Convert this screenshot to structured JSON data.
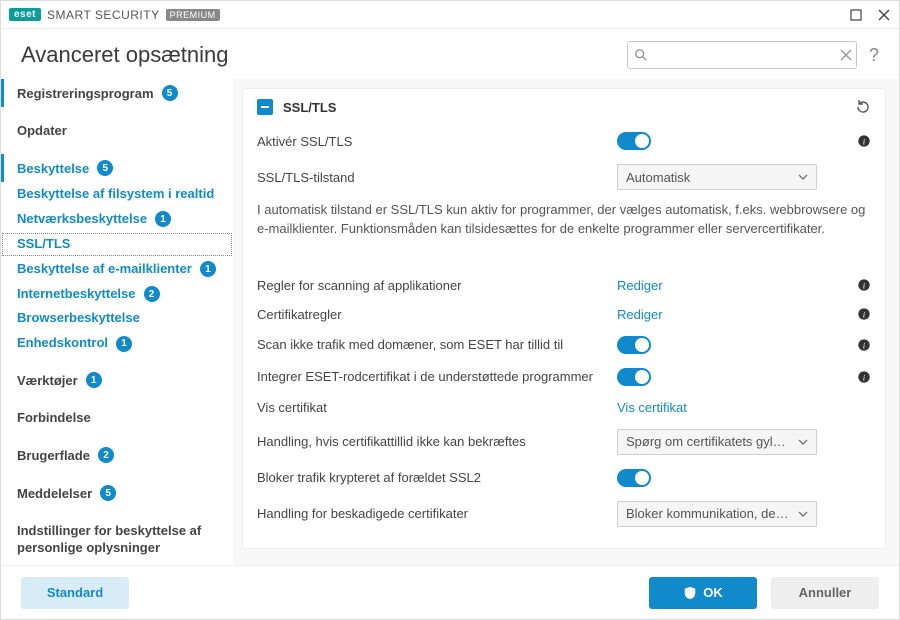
{
  "titlebar": {
    "brand_eset": "eset",
    "brand_name": "SMART SECURITY",
    "brand_premium": "PREMIUM"
  },
  "header": {
    "page_title": "Avanceret opsætning",
    "search_placeholder": ""
  },
  "sidebar": {
    "items": [
      {
        "label": "Registreringsprogram",
        "badge": "5",
        "style": "top"
      },
      {
        "label": "Opdater",
        "style": "top"
      },
      {
        "label": "Beskyttelse",
        "badge": "5",
        "style": "blue-active"
      },
      {
        "label": "Beskyttelse af filsystem i realtid",
        "style": "child"
      },
      {
        "label": "Netværksbeskyttelse",
        "badge": "1",
        "style": "child"
      },
      {
        "label": "SSL/TLS",
        "style": "selected"
      },
      {
        "label": "Beskyttelse af e-mailklienter",
        "badge": "1",
        "style": "child"
      },
      {
        "label": "Internetbeskyttelse",
        "badge": "2",
        "style": "child"
      },
      {
        "label": "Browserbeskyttelse",
        "style": "child"
      },
      {
        "label": "Enhedskontrol",
        "badge": "1",
        "style": "child"
      },
      {
        "label": "Værktøjer",
        "badge": "1",
        "style": "top"
      },
      {
        "label": "Forbindelse",
        "style": "top"
      },
      {
        "label": "Brugerflade",
        "badge": "2",
        "style": "top"
      },
      {
        "label": "Meddelelser",
        "badge": "5",
        "style": "top"
      },
      {
        "label": "Indstillinger for beskyttelse af personlige oplysninger",
        "style": "top-multiline"
      }
    ]
  },
  "panel": {
    "title": "SSL/TLS",
    "rows": {
      "enable_label": "Aktivér SSL/TLS",
      "mode_label": "SSL/TLS-tilstand",
      "mode_value": "Automatisk",
      "description": "I automatisk tilstand er SSL/TLS kun aktiv for programmer, der vælges automatisk, f.eks. webbrowsere og e-mailklienter. Funktionsmåden kan tilsidesættes for de enkelte programmer eller servercertifikater.",
      "app_rules_label": "Regler for scanning af applikationer",
      "app_rules_action": "Rediger",
      "cert_rules_label": "Certifikatregler",
      "cert_rules_action": "Rediger",
      "trusted_domains_label": "Scan ikke trafik med domæner, som ESET har tillid til",
      "integrate_root_label": "Integrer ESET-rodcertifikat i de understøttede programmer",
      "show_cert_label": "Vis certifikat",
      "show_cert_action": "Vis certifikat",
      "untrusted_action_label": "Handling, hvis certifikattillid ikke kan bekræftes",
      "untrusted_action_value": "Spørg om certifikatets gyldi...",
      "block_ssl2_label": "Bloker trafik krypteret af forældet SSL2",
      "damaged_cert_label": "Handling for beskadigede certifikater",
      "damaged_cert_value": "Bloker kommunikation, der b..."
    }
  },
  "footer": {
    "default_label": "Standard",
    "ok_label": "OK",
    "cancel_label": "Annuller"
  }
}
